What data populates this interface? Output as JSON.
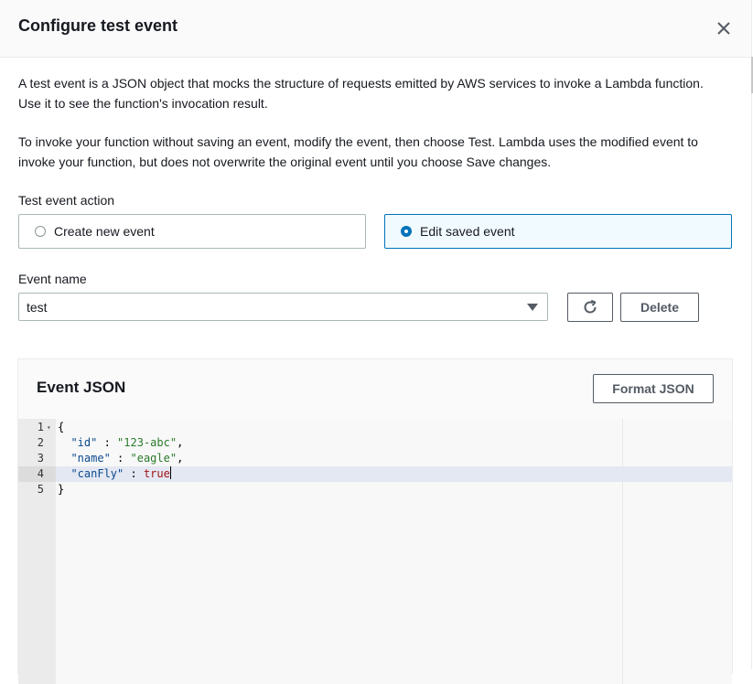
{
  "modal": {
    "title": "Configure test event",
    "close_icon": "close-icon"
  },
  "description": {
    "paragraph1": "A test event is a JSON object that mocks the structure of requests emitted by AWS services to invoke a Lambda function. Use it to see the function's invocation result.",
    "paragraph2": "To invoke your function without saving an event, modify the event, then choose Test. Lambda uses the modified event to invoke your function, but does not overwrite the original event until you choose Save changes."
  },
  "test_event_action": {
    "label": "Test event action",
    "options": [
      {
        "label": "Create new event",
        "selected": false
      },
      {
        "label": "Edit saved event",
        "selected": true
      }
    ]
  },
  "event_name": {
    "label": "Event name",
    "selected_value": "test",
    "refresh_icon": "refresh-icon",
    "delete_label": "Delete"
  },
  "event_json": {
    "title": "Event JSON",
    "format_label": "Format JSON",
    "lines": [
      {
        "number": "1",
        "text": "{"
      },
      {
        "number": "2",
        "key": "\"id\"",
        "sep": " : ",
        "value": "\"123-abc\"",
        "trail": ","
      },
      {
        "number": "3",
        "key": "\"name\"",
        "sep": " : ",
        "value": "\"eagle\"",
        "trail": ","
      },
      {
        "number": "4",
        "key": "\"canFly\"",
        "sep": " : ",
        "value": "true",
        "trail": ""
      },
      {
        "number": "5",
        "text": "}"
      }
    ]
  },
  "colors": {
    "accent": "#0073bb",
    "selected_bg": "#f1faff",
    "text": "#16191f"
  }
}
